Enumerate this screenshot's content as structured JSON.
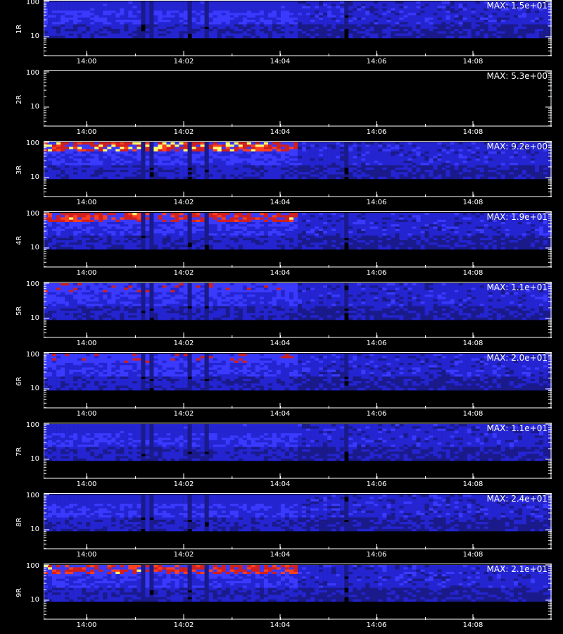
{
  "chart_data": {
    "type": "heatmap",
    "x_ticks": [
      "14:00",
      "14:02",
      "14:04",
      "14:06",
      "14:08"
    ],
    "y_ticks": [
      "100",
      "10"
    ],
    "y_scale": "log",
    "colormap": [
      "#000000",
      "#1a1aa0",
      "#3030ff",
      "#ff3030",
      "#ffff60"
    ],
    "panels": [
      {
        "label": "1R",
        "max_label": "MAX: 1.5e+01",
        "intensity": 0.55
      },
      {
        "label": "2R",
        "max_label": "MAX: 5.3e+00",
        "intensity": 0.0
      },
      {
        "label": "3R",
        "max_label": "MAX: 9.2e+00",
        "intensity": 0.95
      },
      {
        "label": "4R",
        "max_label": "MAX: 1.9e+01",
        "intensity": 0.9
      },
      {
        "label": "5R",
        "max_label": "MAX: 1.1e+01",
        "intensity": 0.75
      },
      {
        "label": "6R",
        "max_label": "MAX: 2.0e+01",
        "intensity": 0.75
      },
      {
        "label": "7R",
        "max_label": "MAX: 1.1e+01",
        "intensity": 0.55
      },
      {
        "label": "8R",
        "max_label": "MAX: 2.4e+01",
        "intensity": 0.5
      },
      {
        "label": "9R",
        "max_label": "MAX: 2.1e+01",
        "intensity": 0.9
      }
    ]
  }
}
